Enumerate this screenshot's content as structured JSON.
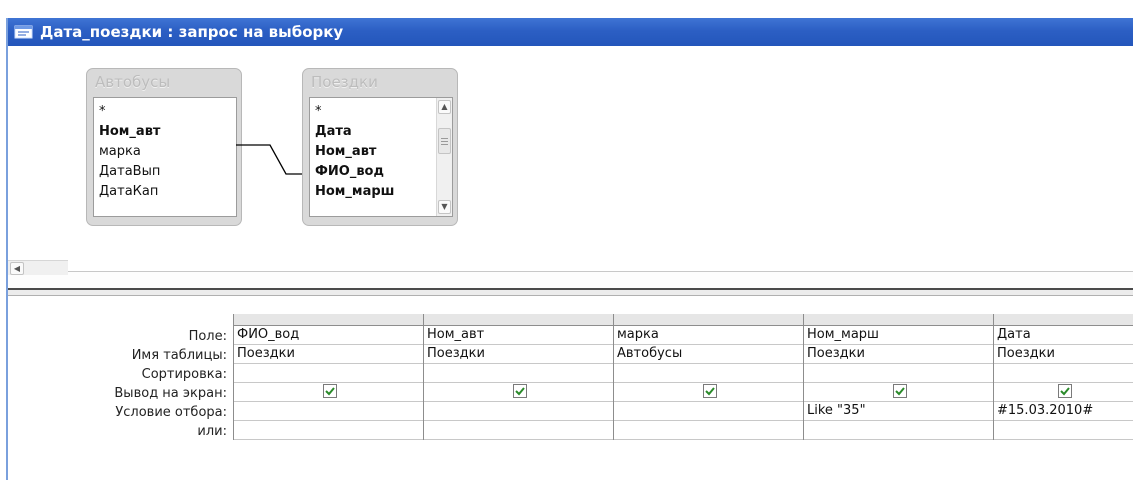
{
  "window": {
    "title": "Дата_поездки : запрос на выборку"
  },
  "tables": [
    {
      "name": "Автобусы",
      "fields": [
        {
          "label": "*",
          "bold": false
        },
        {
          "label": "Ном_авт",
          "bold": true
        },
        {
          "label": "марка",
          "bold": false
        },
        {
          "label": "ДатаВып",
          "bold": false
        },
        {
          "label": "ДатаКап",
          "bold": false
        }
      ]
    },
    {
      "name": "Поездки",
      "fields": [
        {
          "label": "*",
          "bold": false
        },
        {
          "label": "Дата",
          "bold": true
        },
        {
          "label": "Ном_авт",
          "bold": true
        },
        {
          "label": "ФИО_вод",
          "bold": true
        },
        {
          "label": "Ном_марш",
          "bold": true
        }
      ]
    }
  ],
  "grid": {
    "row_labels": [
      "Поле:",
      "Имя таблицы:",
      "Сортировка:",
      "Вывод на экран:",
      "Условие отбора:",
      "или:"
    ],
    "columns": [
      {
        "field": "ФИО_вод",
        "table": "Поездки",
        "sort": "",
        "show": true,
        "criteria": "",
        "or": ""
      },
      {
        "field": "Ном_авт",
        "table": "Поездки",
        "sort": "",
        "show": true,
        "criteria": "",
        "or": ""
      },
      {
        "field": "марка",
        "table": "Автобусы",
        "sort": "",
        "show": true,
        "criteria": "",
        "or": ""
      },
      {
        "field": "Ном_марш",
        "table": "Поездки",
        "sort": "",
        "show": true,
        "criteria": "Like \"35\"",
        "or": ""
      },
      {
        "field": "Дата",
        "table": "Поездки",
        "sort": "",
        "show": true,
        "criteria": "#15.03.2010#",
        "or": ""
      }
    ]
  },
  "icons": {
    "window_icon": "query-window-icon",
    "check": "checkmark-icon",
    "scroll_left": "arrow-left-icon",
    "scroll_up": "arrow-up-icon",
    "scroll_down": "arrow-down-icon"
  },
  "colors": {
    "titlebar": "#2c5fc4",
    "title_text": "#ffffff"
  }
}
